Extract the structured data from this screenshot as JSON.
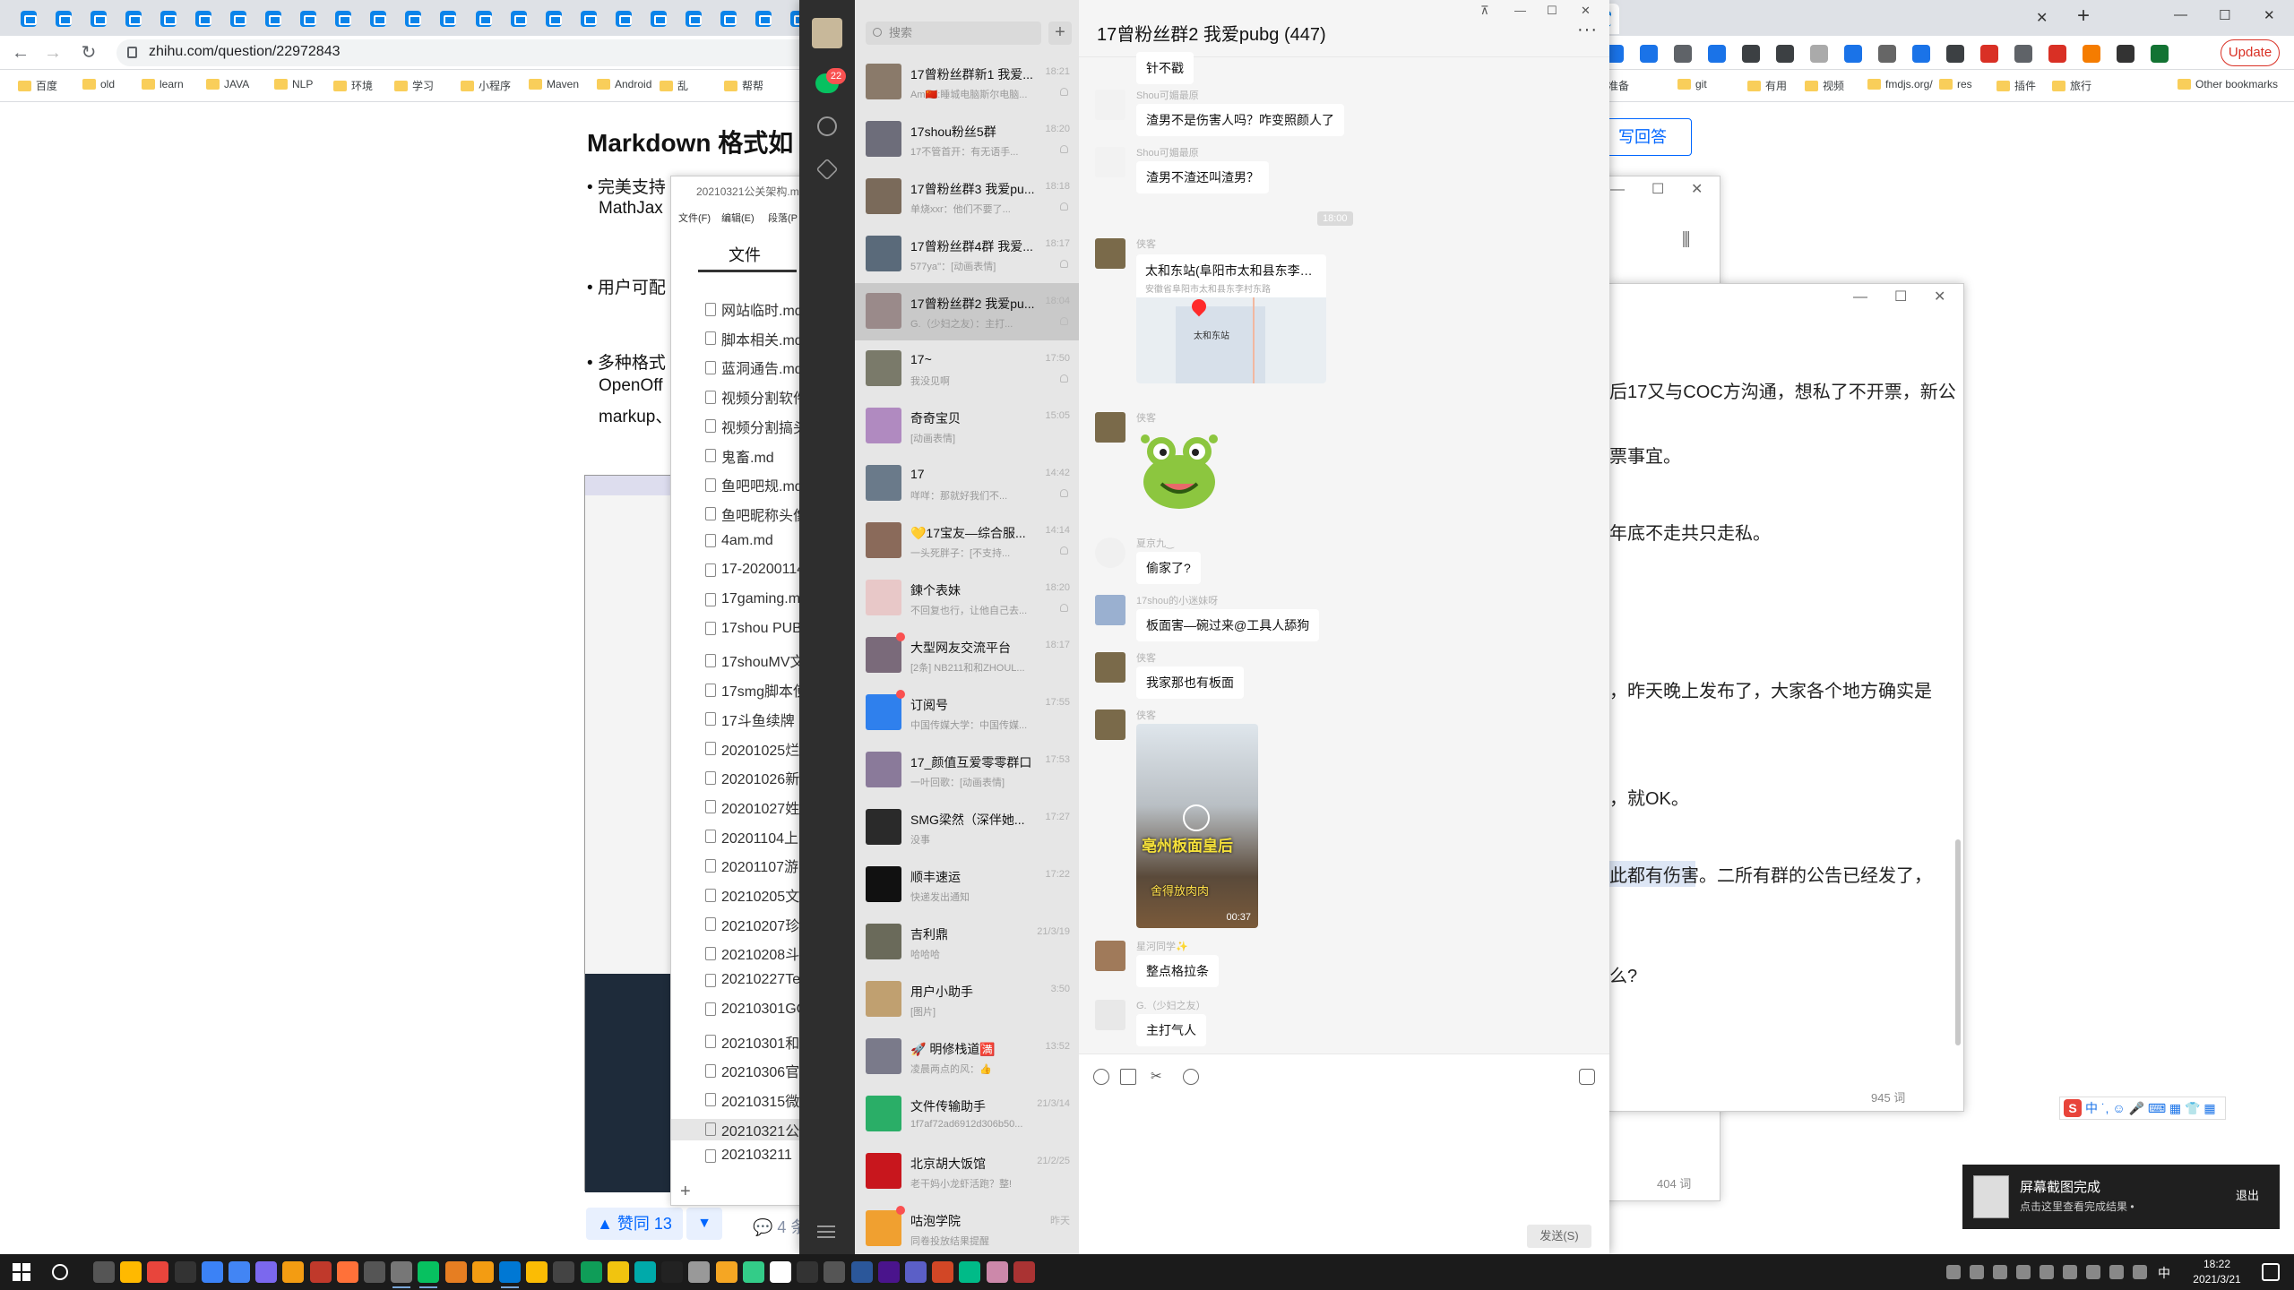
{
  "browser": {
    "url": "zhihu.com/question/22972843",
    "update_label": "Update",
    "bookmarks": [
      "百度",
      "old",
      "learn",
      "JAVA",
      "NLP",
      "环境",
      "学习",
      "小程序",
      "Maven",
      "Android",
      "乱",
      "帮帮",
      "准备",
      "git",
      "有用",
      "视频",
      "fmdjs.org/",
      "res",
      "插件",
      "旅行",
      "Other bookmarks"
    ]
  },
  "zhihu": {
    "title": "Markdown 格式如",
    "answer_button": "写回答",
    "lines": [
      "• 完美支持",
      "MathJax",
      "• 用户可配",
      "• 多种格式",
      "OpenOff",
      "markup、"
    ],
    "vote_label": "▲ 赞同 13",
    "comment_label": "💬 4 条"
  },
  "typora": {
    "title": "20210321公关架构.m",
    "menu": [
      "文件(F)",
      "编辑(E)",
      "段落(P"
    ],
    "tab_label": "文件",
    "files": [
      "网站临时.md",
      "脚本相关.md",
      "蓝洞通告.md",
      "视频分割软件",
      "视频分割搞头",
      "鬼畜.md",
      "鱼吧吧规.md",
      "鱼吧昵称头像",
      "4am.md",
      "17-20200114",
      "17gaming.md",
      "17shou PUB",
      "17shouMV文",
      "17smg脚本使",
      "17斗鱼续牌",
      "20201025烂",
      "20201026新",
      "20201027姓",
      "20201104上",
      "20201107游",
      "20210205文",
      "20210207珍",
      "20210208斗",
      "20210227Te",
      "20210301GO",
      "20210301和",
      "20210306官",
      "20210315微",
      "20210321公",
      "202103211"
    ]
  },
  "notes_window": {
    "lines": [
      "后17又与COC方沟通，想私了不开票，新公",
      "票事宜。",
      "年底不走共只走私。",
      "，昨天晚上发布了，大家各个地方确实是",
      "，就OK。",
      "此都有伤害。二所有群的公告已经发了，",
      "么?"
    ],
    "word_count_a": "945 词",
    "word_count_b": "404 词"
  },
  "wechat": {
    "unread_badge": "22",
    "search_placeholder": "搜索",
    "chat_title": "17曾粉丝群2 我爱pubg (447)",
    "conversations": [
      {
        "name": "17曾粉丝群新1 我爱...",
        "preview": "Am🇨🇳:睡城电脑斯尔电脑...",
        "time": "18:21",
        "selected": false,
        "color": "#8a7a6a"
      },
      {
        "name": "17shou粉丝5群",
        "preview": "17不管首开：有无语手...",
        "time": "18:20",
        "selected": false,
        "color": "#6d6d7a"
      },
      {
        "name": "17曾粉丝群3 我爱pu...",
        "preview": "单烧xxr：他们不要了...",
        "time": "18:18",
        "selected": false,
        "color": "#7a6a5a"
      },
      {
        "name": "17曾粉丝群4群 我爱...",
        "preview": "577ya''：[动画表情]",
        "time": "18:17",
        "selected": false,
        "color": "#5a6a7a"
      },
      {
        "name": "17曾粉丝群2 我爱pu...",
        "preview": "G.（少妇之友）：主打...",
        "time": "18:04",
        "selected": true,
        "color": "#9a8a8a"
      },
      {
        "name": "17~",
        "preview": "我没见啊",
        "time": "17:50",
        "selected": false,
        "color": "#7a7a6a"
      },
      {
        "name": "奇奇宝贝",
        "preview": "[动画表情]",
        "time": "15:05",
        "selected": false,
        "color": "#b08ac0"
      },
      {
        "name": "17",
        "preview": "咩咩：那就好我们不...",
        "time": "14:42",
        "selected": false,
        "color": "#6a7a8a"
      },
      {
        "name": "💛17宝友—综合服...",
        "preview": "一头死胖子：[不支持...",
        "time": "14:14",
        "selected": false,
        "color": "#8a6a5a"
      },
      {
        "name": "鍊个表妹",
        "preview": "不回复也行，让他自己去...",
        "time": "18:20",
        "selected": false,
        "color": "#e8c8c8"
      },
      {
        "name": "大型网友交流平台",
        "preview": "[2条] NB211和和ZHOUL...",
        "time": "18:17",
        "selected": false,
        "color": "#7a6a7a",
        "dot": true
      },
      {
        "name": "订阅号",
        "preview": "中国传媒大学：中国传媒...",
        "time": "17:55",
        "selected": false,
        "color": "#2f80ed",
        "dot": true
      },
      {
        "name": "17_颜值互爱零零群口",
        "preview": "一叶回歌：[动画表情]",
        "time": "17:53",
        "selected": false,
        "color": "#8a7a9a"
      },
      {
        "name": "SMG梁然（深伴她...",
        "preview": "没事",
        "time": "17:27",
        "selected": false,
        "color": "#2a2a2a"
      },
      {
        "name": "顺丰速运",
        "preview": "快递发出通知",
        "time": "17:22",
        "selected": false,
        "color": "#111111"
      },
      {
        "name": "吉利鼎",
        "preview": "哈哈哈",
        "time": "21/3/19",
        "selected": false,
        "color": "#6a6a5a"
      },
      {
        "name": "用户小助手",
        "preview": "[图片]",
        "time": "3:50",
        "selected": false,
        "color": "#c0a070"
      },
      {
        "name": "🚀 明修栈道🈵",
        "preview": "凌晨两点的风：👍",
        "time": "13:52",
        "selected": false,
        "color": "#7a7a8a"
      },
      {
        "name": "文件传输助手",
        "preview": "1f7af72ad6912d306b50...",
        "time": "21/3/14",
        "selected": false,
        "color": "#2aae67"
      },
      {
        "name": "北京胡大饭馆",
        "preview": "老干妈小龙虾活跑？整!",
        "time": "21/2/25",
        "selected": false,
        "color": "#c8161d"
      },
      {
        "name": "咕泡学院",
        "preview": "同卷投放结果提醒",
        "time": "昨天",
        "selected": false,
        "color": "#f0a030",
        "dot": true
      }
    ],
    "messages": [
      {
        "sender": "",
        "text": "针不戳",
        "avatar_color": "#ffffff"
      },
      {
        "sender": "Shou可媚最原",
        "text": "渣男不是伤害人吗？咋变照颜人了",
        "avatar_color": "#eeeeee"
      },
      {
        "sender": "Shou可媚最原",
        "text": "渣男不渣还叫渣男？",
        "avatar_color": "#eeeeee"
      },
      {
        "sender": "侠客",
        "text": "",
        "avatar_color": "#7a6a4a"
      },
      {
        "sender": "侠客",
        "text": "",
        "avatar_color": "#7a6a4a"
      },
      {
        "sender": "夏京九‿",
        "text": "偷家了?",
        "avatar_color": "#f0f0f0"
      },
      {
        "sender": "17shou的小迷妹呀",
        "text": "板面害—碗过来@工具人舔狗",
        "avatar_color": "#9ab0d0"
      },
      {
        "sender": "侠客",
        "text": "我家那也有板面",
        "avatar_color": "#7a6a4a"
      },
      {
        "sender": "侠客",
        "text": "",
        "avatar_color": "#7a6a4a"
      },
      {
        "sender": "星河同学✨",
        "text": "整点格拉条",
        "avatar_color": "#a07a5a"
      },
      {
        "sender": "G.（少妇之友）",
        "text": "主打气人",
        "avatar_color": "#e8e8e8"
      }
    ],
    "time_separator": "18:00",
    "location": {
      "title": "太和东站(阜阳市太和县东李村...",
      "subtitle": "安徽省阜阳市太和县东李村东路",
      "map_label": "太和东站"
    },
    "video": {
      "caption1": "亳州板面皇后",
      "caption2": "舍得放肉肉",
      "duration": "00:37"
    },
    "send_label": "发送(S)"
  },
  "toast": {
    "title": "屏幕截图完成",
    "subtitle": "点击这里查看完成结果 •",
    "exit": "退出"
  },
  "taskbar": {
    "time": "18:22",
    "date": "2021/3/21",
    "lang": "中"
  },
  "ime": {
    "text": "中 ˙, ☺ 🎤 ⌨ ▦ 👕 ▦"
  }
}
